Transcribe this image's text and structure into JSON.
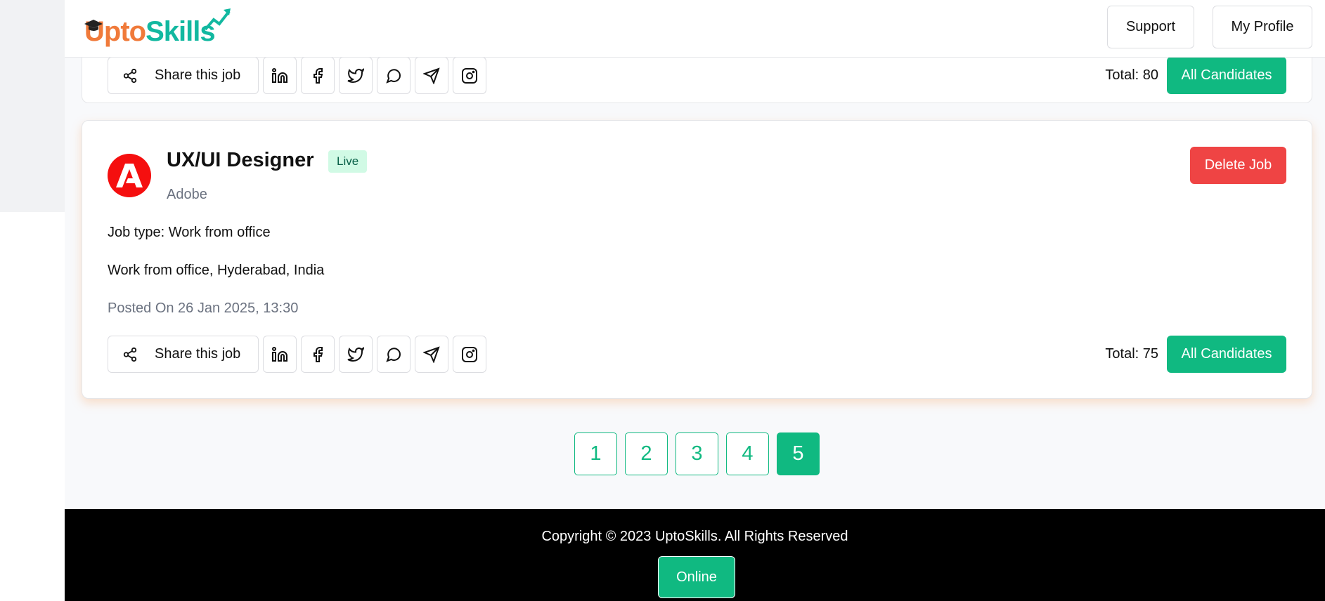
{
  "header": {
    "logo_upto": "Upto",
    "logo_skills": "Skills",
    "support_label": "Support",
    "profile_label": "My Profile"
  },
  "cards": [
    {
      "share_label": "Share this job",
      "total_label": "Total: 80",
      "all_candidates_label": "All Candidates"
    },
    {
      "title": "UX/UI Designer",
      "status": "Live",
      "company": "Adobe",
      "job_type": "Job type: Work from office",
      "location": "Work from office, Hyderabad, India",
      "posted": "Posted On 26 Jan 2025, 13:30",
      "delete_label": "Delete Job",
      "share_label": "Share this job",
      "total_label": "Total: 75",
      "all_candidates_label": "All Candidates"
    }
  ],
  "social_icons": [
    "linkedin-icon",
    "facebook-icon",
    "twitter-icon",
    "whatsapp-icon",
    "telegram-icon",
    "instagram-icon"
  ],
  "pagination": {
    "pages": [
      "1",
      "2",
      "3",
      "4",
      "5"
    ],
    "active": "5"
  },
  "footer": {
    "copyright": "Copyright © 2023 UptoSkills. All Rights Reserved",
    "online_label": "Online"
  },
  "colors": {
    "primary_green": "#10b981",
    "danger_red": "#ef4444",
    "logo_orange": "#f07a3a",
    "logo_teal": "#12b8a0",
    "adobe_red": "#f50f0f"
  }
}
